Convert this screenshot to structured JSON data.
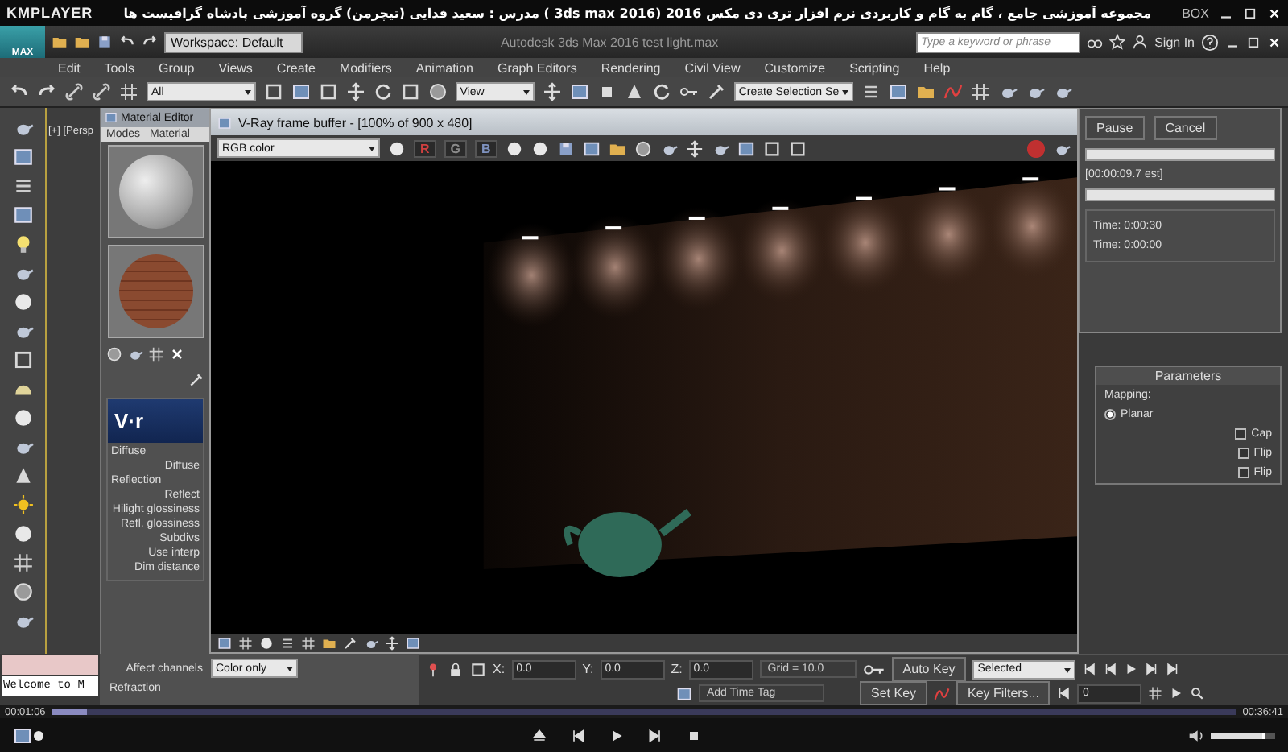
{
  "player": {
    "logo": "KMPLAYER",
    "title": "مجموعه آموزشی جامع ، گام به گام و کاربردی نرم افزار تری دی مکس 2016 (3ds max 2016 ) مدرس : سعید فدایی (تیچرمن) گروه آموزشی پادشاه گرافیست ها",
    "box_label": "BOX",
    "elapsed": "00:01:06",
    "duration": "00:36:41",
    "progress": {
      "level": 0.03
    },
    "volume": {
      "level": 0.85
    }
  },
  "app": {
    "logo": "MAX",
    "workspace": "Workspace: Default",
    "title": "Autodesk 3ds Max 2016    test light.max",
    "search": {
      "placeholder": "Type a keyword or phrase"
    },
    "sign_in": "Sign In"
  },
  "menu": [
    "Edit",
    "Tools",
    "Group",
    "Views",
    "Create",
    "Modifiers",
    "Animation",
    "Graph Editors",
    "Rendering",
    "Civil View",
    "Customize",
    "Scripting",
    "Help"
  ],
  "toolbar": {
    "selection_filter": "All",
    "reference_coord": "View",
    "named_selection": "Create Selection Se"
  },
  "viewport_label": "[+] [Persp",
  "material_editor": {
    "title": "Material Editor",
    "menus": [
      "Modes",
      "Material"
    ],
    "rollout_logo": "V·r",
    "params": [
      {
        "text": "Diffuse",
        "kind": "group"
      },
      {
        "text": "Diffuse",
        "kind": "label"
      },
      {
        "text": "Reflection",
        "kind": "group"
      },
      {
        "text": "Reflect",
        "kind": "label"
      },
      {
        "text": "Hilight glossiness",
        "kind": "label"
      },
      {
        "text": "Refl. glossiness",
        "kind": "label"
      },
      {
        "text": "Subdivs",
        "kind": "label"
      },
      {
        "text": "Use interp",
        "kind": "label"
      },
      {
        "text": "Dim distance",
        "kind": "label"
      }
    ],
    "affect_channels": {
      "label": "Affect channels",
      "value": "Color only"
    },
    "refraction": "Refraction"
  },
  "frame_buffer": {
    "title": "V-Ray frame buffer - [100% of 900 x 480]",
    "channel": "RGB color",
    "channels": [
      {
        "label": "R",
        "color": "#d04040"
      },
      {
        "label": "G",
        "color": "#8a8a8a"
      },
      {
        "label": "B",
        "color": "#7f93c0"
      }
    ]
  },
  "render_dialog": {
    "buttons": [
      "Pause",
      "Cancel"
    ],
    "bars": [
      {
        "level": 1
      },
      {
        "level": 1
      }
    ],
    "estimate": "[00:00:09.7 est]",
    "times": [
      "Time:  0:00:30",
      "Time:  0:00:00"
    ]
  },
  "command_panel": {
    "rollout": "Parameters",
    "mapping_label": "Mapping:",
    "planar": {
      "label": "Planar",
      "selected": true
    },
    "cap": {
      "label": "Cap",
      "checked": false
    },
    "flips": [
      {
        "label": "Flip",
        "checked": false
      },
      {
        "label": "Flip",
        "checked": false
      }
    ]
  },
  "status": {
    "welcome": "Welcome to M",
    "coords": [
      {
        "axis": "X:",
        "value": "0.0"
      },
      {
        "axis": "Y:",
        "value": "0.0"
      },
      {
        "axis": "Z:",
        "value": "0.0"
      }
    ],
    "grid": "Grid = 10.0",
    "add_time_tag": "Add Time Tag",
    "auto_key": "Auto Key",
    "key_mode": "Selected",
    "set_key": "Set Key",
    "key_filters": "Key Filters...",
    "frame": "0"
  }
}
